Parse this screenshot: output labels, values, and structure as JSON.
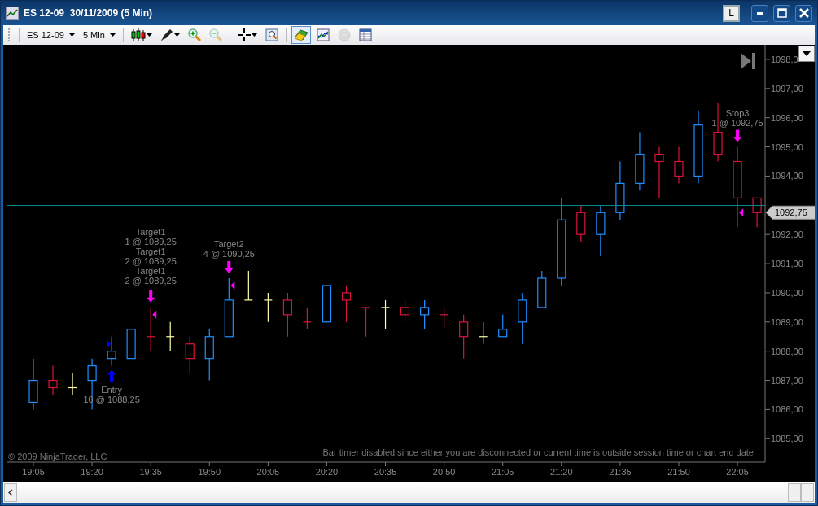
{
  "window": {
    "title": "ES 12-09  30/11/2009 (5 Min)",
    "layout_button": "L"
  },
  "toolbar": {
    "instrument": "ES 12-09",
    "interval": "5 Min",
    "tools": [
      {
        "kind": "candles",
        "caret": true,
        "selected": false,
        "disabled": false
      },
      {
        "kind": "pen",
        "caret": true,
        "selected": false,
        "disabled": false
      },
      {
        "kind": "zoom-in",
        "caret": false,
        "selected": false,
        "disabled": false
      },
      {
        "kind": "zoom-out",
        "caret": false,
        "selected": false,
        "disabled": true
      },
      {
        "kind": "crosshair",
        "caret": true,
        "selected": false,
        "disabled": false
      },
      {
        "kind": "properties",
        "caret": false,
        "selected": false,
        "disabled": false
      },
      {
        "kind": "chart-trader",
        "caret": false,
        "selected": true,
        "disabled": false
      },
      {
        "kind": "indicators",
        "caret": false,
        "selected": false,
        "disabled": false
      },
      {
        "kind": "strategies",
        "caret": false,
        "selected": false,
        "disabled": true
      },
      {
        "kind": "data-box",
        "caret": false,
        "selected": false,
        "disabled": false
      }
    ]
  },
  "chart": {
    "copyright": "© 2009 NinjaTrader, LLC",
    "notice": "Bar timer disabled since either you are disconnected or current time is outside session time or chart end date",
    "last_price": "1092,75",
    "executions": [
      {
        "kind": "buy"
      },
      {
        "kind": "sell"
      },
      {
        "kind": "sell"
      },
      {
        "kind": "sell"
      }
    ],
    "chart_data": {
      "type": "candlestick",
      "categories": [
        "19:05",
        null,
        null,
        "19:20",
        null,
        null,
        "19:35",
        null,
        null,
        "19:50",
        null,
        null,
        "20:05",
        null,
        null,
        "20:20",
        null,
        null,
        "20:35",
        null,
        null,
        "20:50",
        null,
        null,
        "21:05",
        null,
        null,
        "21:20",
        null,
        null,
        "21:35",
        null,
        null,
        "21:50",
        null,
        null,
        "22:05",
        null
      ],
      "ohlc": [
        [
          1086.25,
          1087.75,
          1086,
          1087
        ],
        [
          1087,
          1087.5,
          1086.5,
          1086.75
        ],
        [
          1086.75,
          1087.25,
          1086.5,
          1086.75
        ],
        [
          1087,
          1087.75,
          1086,
          1087.5
        ],
        [
          1087.75,
          1088.5,
          1087.5,
          1088
        ],
        [
          1087.75,
          1088.75,
          1087.75,
          1088.75
        ],
        [
          1088.5,
          1089.5,
          1088,
          1088.5
        ],
        [
          1088.5,
          1089,
          1088,
          1088.5
        ],
        [
          1088.25,
          1088.5,
          1087.25,
          1087.75
        ],
        [
          1087.75,
          1088.75,
          1087,
          1088.5
        ],
        [
          1088.5,
          1090.5,
          1088.5,
          1089.75
        ],
        [
          1089.75,
          1090.75,
          1089.75,
          1089.75
        ],
        [
          1089.75,
          1090,
          1089,
          1089.75
        ],
        [
          1089.75,
          1090,
          1088.5,
          1089.25
        ],
        [
          1089,
          1089.5,
          1088.75,
          1089
        ],
        [
          1089,
          1090.25,
          1089,
          1090.25
        ],
        [
          1090,
          1090.25,
          1089,
          1089.75
        ],
        [
          1089.5,
          1089.5,
          1088.5,
          1089.5
        ],
        [
          1089.5,
          1089.75,
          1088.75,
          1089.5
        ],
        [
          1089.5,
          1089.75,
          1089,
          1089.25
        ],
        [
          1089.25,
          1089.75,
          1088.75,
          1089.5
        ],
        [
          1089.25,
          1089.5,
          1088.75,
          1089.25
        ],
        [
          1089,
          1089.25,
          1087.75,
          1088.5
        ],
        [
          1088.5,
          1089,
          1088.25,
          1088.5
        ],
        [
          1088.5,
          1089.25,
          1088.5,
          1088.75
        ],
        [
          1089,
          1090,
          1088.25,
          1089.75
        ],
        [
          1089.5,
          1090.75,
          1089.5,
          1090.5
        ],
        [
          1090.5,
          1093.25,
          1090.25,
          1092.5
        ],
        [
          1092.75,
          1093,
          1091.75,
          1092
        ],
        [
          1092,
          1093,
          1091.25,
          1092.75
        ],
        [
          1092.75,
          1094.5,
          1092.5,
          1093.75
        ],
        [
          1093.75,
          1095.5,
          1093.5,
          1094.75
        ],
        [
          1094.75,
          1095,
          1093.25,
          1094.5
        ],
        [
          1094.5,
          1095,
          1093.75,
          1094
        ],
        [
          1094,
          1096.25,
          1093.75,
          1095.75
        ],
        [
          1095.5,
          1096.5,
          1094.5,
          1094.75
        ],
        [
          1094.5,
          1095,
          1092.25,
          1093.25
        ],
        [
          1093.25,
          1093.25,
          1092.25,
          1092.75
        ]
      ],
      "ylim": [
        1084.2,
        1098.5
      ],
      "yticks": [
        {
          "value": 1085,
          "label": "1085,00"
        },
        {
          "value": 1086,
          "label": "1086,00"
        },
        {
          "value": 1087,
          "label": "1087,00"
        },
        {
          "value": 1088,
          "label": "1088,00"
        },
        {
          "value": 1089,
          "label": "1089,00"
        },
        {
          "value": 1090,
          "label": "1090,00"
        },
        {
          "value": 1091,
          "label": "1091,00"
        },
        {
          "value": 1092,
          "label": "1092,00"
        },
        {
          "value": 1094,
          "label": "1094,00"
        },
        {
          "value": 1095,
          "label": "1095,00"
        },
        {
          "value": 1096,
          "label": "1096,00"
        },
        {
          "value": 1097,
          "label": "1097,00"
        },
        {
          "value": 1098,
          "label": "1098,0"
        }
      ],
      "annotations": [
        "Entry\n10 @ 1088,25",
        "Target1\n1 @ 1089,25\nTarget1\n2 @ 1089,25\nTarget1\n2 @ 1089,25",
        "Target2\n4 @ 1090,25",
        "Stop3\n1 @ 1092,75"
      ]
    }
  }
}
